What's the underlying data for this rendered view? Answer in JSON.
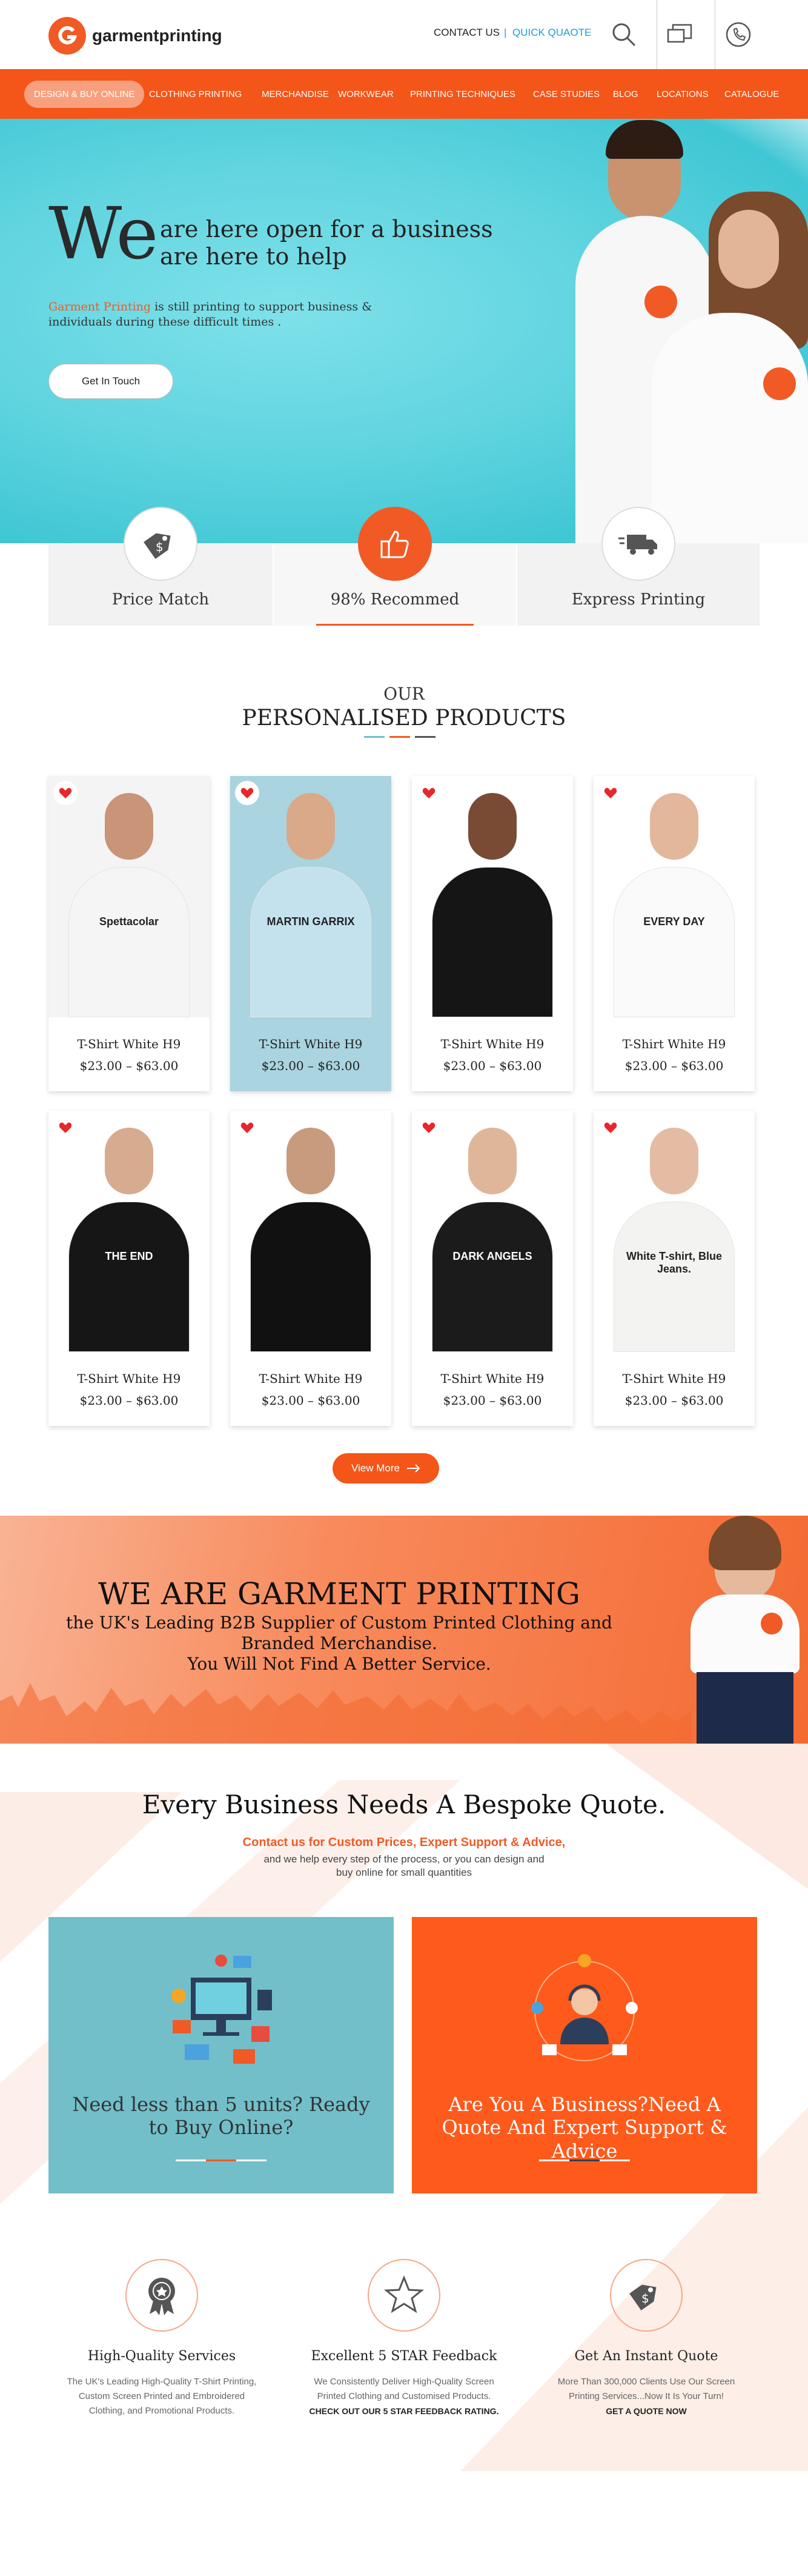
{
  "header": {
    "logo_text": "garmentprinting",
    "contact_label": "CONTACT US",
    "separator": "|",
    "quote_label": "QUICK QUAOTE"
  },
  "nav": {
    "items": [
      "DESIGN & BUY ONLINE",
      "CLOTHING PRINTING",
      "MERCHANDISE",
      "WORKWEAR",
      "PRINTING TECHNIQUES",
      "CASE STUDIES",
      "BLOG",
      "LOCATIONS",
      "CATALOGUE"
    ]
  },
  "hero": {
    "we": "We",
    "line1": "are here  open for a business",
    "line2": "are here to help",
    "sub_brand": "Garment Printing",
    "sub_text": " is still printing to support business  &  individuals  during  these difficult times .",
    "button": "Get In Touch"
  },
  "features": [
    {
      "label": "Price Match",
      "icon": "price-tag-icon"
    },
    {
      "label": "98% Recommed",
      "icon": "thumbs-up-icon"
    },
    {
      "label": "Express Printing",
      "icon": "delivery-truck-icon"
    }
  ],
  "products_section": {
    "small": "OUR",
    "big": "PERSONALISED PRODUCTS",
    "view_more": "View More"
  },
  "products": [
    {
      "name": "T-Shirt White H9",
      "price": "$23.00 – $63.00",
      "shirt": "#f5f5f5",
      "bg": "#f4f4f4",
      "skin": "#c99478",
      "print": "Spettacolar"
    },
    {
      "name": "T-Shirt White H9",
      "price": "$23.00 – $63.00",
      "shirt": "#c4e2ee",
      "bg": "#a9d4e0",
      "skin": "#d9a98a",
      "print": "MARTIN GARRIX"
    },
    {
      "name": "T-Shirt White H9",
      "price": "$23.00 – $63.00",
      "shirt": "#151515",
      "bg": "#ffffff",
      "skin": "#7a4b34",
      "print": ""
    },
    {
      "name": "T-Shirt White H9",
      "price": "$23.00 – $63.00",
      "shirt": "#fafafa",
      "bg": "#ffffff",
      "skin": "#e2b79c",
      "print": "EVERY DAY"
    },
    {
      "name": "T-Shirt White H9",
      "price": "$23.00 – $63.00",
      "shirt": "#161616",
      "bg": "#ffffff",
      "skin": "#d6ab90",
      "print": "THE END"
    },
    {
      "name": "T-Shirt White H9",
      "price": "$23.00 – $63.00",
      "shirt": "#111111",
      "bg": "#ffffff",
      "skin": "#c89b7e",
      "print": ""
    },
    {
      "name": "T-Shirt White H9",
      "price": "$23.00 – $63.00",
      "shirt": "#1b1b1b",
      "bg": "#ffffff",
      "skin": "#e0b69a",
      "print": "DARK ANGELS"
    },
    {
      "name": "T-Shirt White H9",
      "price": "$23.00 – $63.00",
      "shirt": "#f3f3f1",
      "bg": "#ffffff",
      "skin": "#e3bca3",
      "print": "White T-shirt, Blue Jeans."
    }
  ],
  "banner": {
    "title": "WE ARE GARMENT PRINTING",
    "line1": "the UK's Leading B2B Supplier of Custom Printed Clothing and",
    "line2": "Branded Merchandise.",
    "line3": "You Will Not Find A Better Service."
  },
  "quote": {
    "title": "Every Business Needs A Bespoke Quote.",
    "sub1": "Contact us for Custom Prices, Expert Support & Advice,",
    "sub2": "and we help every step of the process, or you can design and buy online for small quantities",
    "box_left": "Need less than 5 units? Ready to Buy Online?",
    "box_right": "Are You A Business?Need A Quote And Expert Support  & Advice"
  },
  "services": [
    {
      "title": "High-Quality Services",
      "desc": "The UK's Leading High-Quality T-Shirt Printing, Custom Screen Printed and Embroidered Clothing, and Promotional Products.",
      "link": "",
      "icon": "award-badge-icon"
    },
    {
      "title": "Excellent 5 STAR Feedback",
      "desc": "We Consistently Deliver High-Quality Screen Printed Clothing and Customised Products.",
      "link": "CHECK OUT OUR 5 STAR FEEDBACK RATING.",
      "icon": "star-icon"
    },
    {
      "title": "Get An Instant Quote",
      "desc": "More Than 300,000 Clients Use Our Screen Printing Services...Now It Is Your Turn!",
      "link": "GET A QUOTE NOW",
      "icon": "price-tag-icon"
    }
  ],
  "colors": {
    "accent": "#f45519",
    "teal": "#72bfca",
    "orange": "#fe5a1c"
  }
}
